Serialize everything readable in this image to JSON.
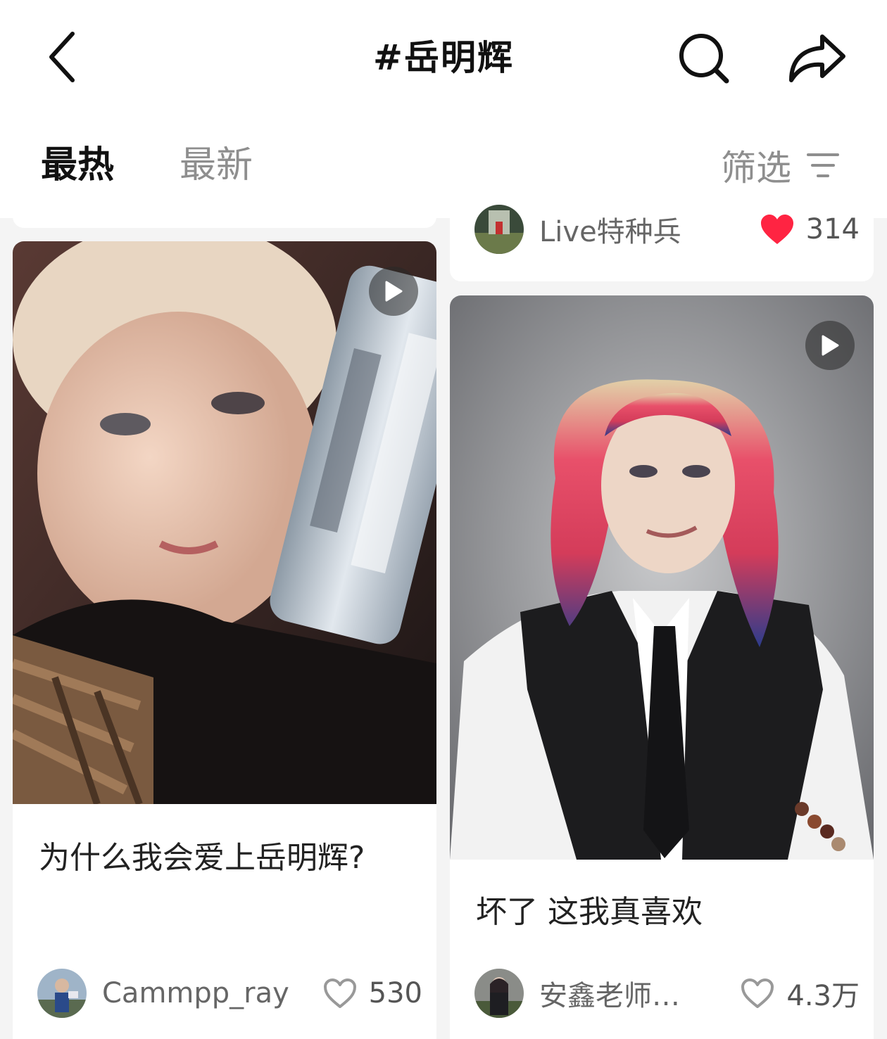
{
  "header": {
    "title": "#岳明辉"
  },
  "tabs": {
    "hot": "最热",
    "new": "最新",
    "filter": "筛选"
  },
  "colors": {
    "like_active": "#ff2442",
    "text_primary": "#222222",
    "text_secondary": "#8e8e8e"
  },
  "feed": {
    "prev_right": {
      "author": "Live特种兵",
      "likes": "314",
      "liked": true
    },
    "left_card": {
      "title": "为什么我会爱上岳明辉?",
      "author": "Cammpp_ray",
      "likes": "530",
      "liked": false,
      "is_video": true
    },
    "right_card": {
      "title": "坏了 这我真喜欢",
      "author": "安鑫老师…",
      "likes": "4.3万",
      "liked": false,
      "is_video": true
    }
  }
}
